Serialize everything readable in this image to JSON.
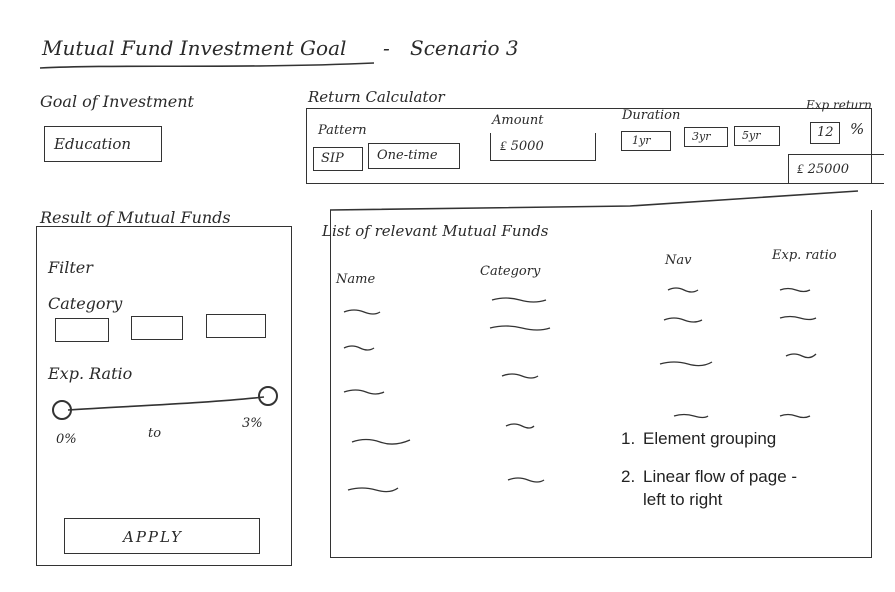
{
  "page_title": "Mutual Fund Investment Goal",
  "scenario": "Scenario 3",
  "goal": {
    "heading": "Goal of Investment",
    "value": "Education"
  },
  "calculator": {
    "heading": "Return Calculator",
    "pattern_label": "Pattern",
    "pattern_options": [
      "SIP",
      "One-time"
    ],
    "amount_label": "Amount",
    "amount_value": "₤ 5000",
    "duration_label": "Duration",
    "duration_options": [
      "1yr",
      "3yr",
      "5yr"
    ],
    "exp_return_label": "Exp return",
    "exp_return_value": "12",
    "exp_return_unit": "%",
    "result_value": "₤ 25000"
  },
  "result_panel": {
    "heading": "Result of Mutual Funds",
    "filter_label": "Filter",
    "category_label": "Category",
    "exp_ratio_label": "Exp. Ratio",
    "slider_min": "0%",
    "slider_to": "to",
    "slider_max": "3%",
    "apply_label": "APPLY"
  },
  "fund_list": {
    "heading": "List of relevant Mutual Funds",
    "columns": [
      "Name",
      "Category",
      "Nav",
      "Exp. ratio"
    ]
  },
  "notes": [
    {
      "num": "1.",
      "text": "Element grouping"
    },
    {
      "num": "2.",
      "text": "Linear flow of page -"
    },
    {
      "num": "",
      "text": "left to right"
    }
  ]
}
